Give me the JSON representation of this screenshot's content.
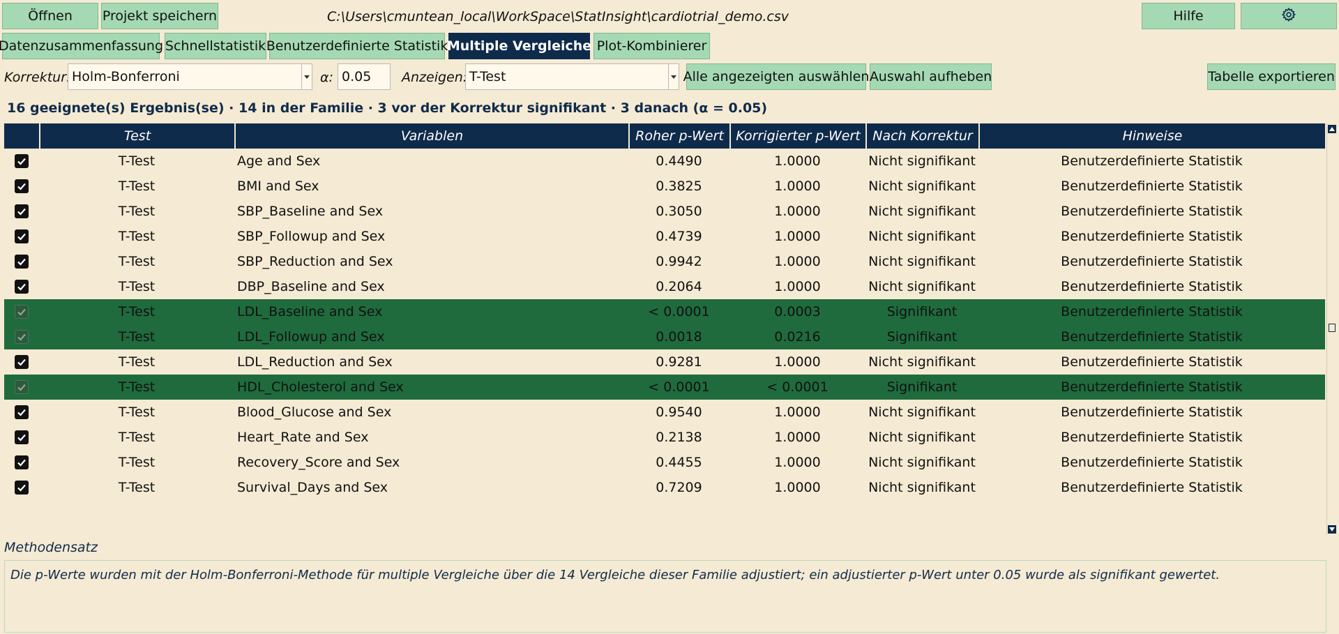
{
  "toolbar": {
    "open_label": "Öffnen",
    "save_label": "Projekt speichern",
    "file_path": "C:\\Users\\cmuntean_local\\WorkSpace\\StatInsight\\cardiotrial_demo.csv",
    "help_label": "Hilfe",
    "settings_icon": "gear-icon"
  },
  "tabs": [
    {
      "label": "Datenzusammenfassung",
      "active": false
    },
    {
      "label": "Schnellstatistik",
      "active": false
    },
    {
      "label": "Benutzerdefinierte Statistik",
      "active": false
    },
    {
      "label": "Multiple Vergleiche",
      "active": true
    },
    {
      "label": "Plot-Kombinierer",
      "active": false
    }
  ],
  "controls": {
    "correction_label": "Korrektur:",
    "correction_value": "Holm-Bonferroni",
    "alpha_label": "α:",
    "alpha_value": "0.05",
    "show_label": "Anzeigen:",
    "show_value": "T-Test",
    "select_all_label": "Alle angezeigten auswählen",
    "deselect_label": "Auswahl aufheben",
    "export_label": "Tabelle exportieren"
  },
  "summary": "16 geeignete(s) Ergebnis(se) · 14 in der Familie · 3 vor der Korrektur signifikant · 3 danach (α = 0.05)",
  "table": {
    "headers": [
      "Test",
      "Variablen",
      "Roher p-Wert",
      "Korrigierter p-Wert",
      "Nach Korrektur",
      "Hinweise"
    ],
    "rows": [
      {
        "test": "T-Test",
        "vars": "Age and Sex",
        "raw": "0.4490",
        "corr": "1.0000",
        "after": "Nicht signifikant",
        "note": "Benutzerdefinierte Statistik",
        "sig": false
      },
      {
        "test": "T-Test",
        "vars": "BMI and Sex",
        "raw": "0.3825",
        "corr": "1.0000",
        "after": "Nicht signifikant",
        "note": "Benutzerdefinierte Statistik",
        "sig": false
      },
      {
        "test": "T-Test",
        "vars": "SBP_Baseline and Sex",
        "raw": "0.3050",
        "corr": "1.0000",
        "after": "Nicht signifikant",
        "note": "Benutzerdefinierte Statistik",
        "sig": false
      },
      {
        "test": "T-Test",
        "vars": "SBP_Followup and Sex",
        "raw": "0.4739",
        "corr": "1.0000",
        "after": "Nicht signifikant",
        "note": "Benutzerdefinierte Statistik",
        "sig": false
      },
      {
        "test": "T-Test",
        "vars": "SBP_Reduction and Sex",
        "raw": "0.9942",
        "corr": "1.0000",
        "after": "Nicht signifikant",
        "note": "Benutzerdefinierte Statistik",
        "sig": false
      },
      {
        "test": "T-Test",
        "vars": "DBP_Baseline and Sex",
        "raw": "0.2064",
        "corr": "1.0000",
        "after": "Nicht signifikant",
        "note": "Benutzerdefinierte Statistik",
        "sig": false
      },
      {
        "test": "T-Test",
        "vars": "LDL_Baseline and Sex",
        "raw": "< 0.0001",
        "corr": "0.0003",
        "after": "Signifikant",
        "note": "Benutzerdefinierte Statistik",
        "sig": true
      },
      {
        "test": "T-Test",
        "vars": "LDL_Followup and Sex",
        "raw": "0.0018",
        "corr": "0.0216",
        "after": "Signifikant",
        "note": "Benutzerdefinierte Statistik",
        "sig": true
      },
      {
        "test": "T-Test",
        "vars": "LDL_Reduction and Sex",
        "raw": "0.9281",
        "corr": "1.0000",
        "after": "Nicht signifikant",
        "note": "Benutzerdefinierte Statistik",
        "sig": false
      },
      {
        "test": "T-Test",
        "vars": "HDL_Cholesterol and Sex",
        "raw": "< 0.0001",
        "corr": "< 0.0001",
        "after": "Signifikant",
        "note": "Benutzerdefinierte Statistik",
        "sig": true
      },
      {
        "test": "T-Test",
        "vars": "Blood_Glucose and Sex",
        "raw": "0.9540",
        "corr": "1.0000",
        "after": "Nicht signifikant",
        "note": "Benutzerdefinierte Statistik",
        "sig": false
      },
      {
        "test": "T-Test",
        "vars": "Heart_Rate and Sex",
        "raw": "0.2138",
        "corr": "1.0000",
        "after": "Nicht signifikant",
        "note": "Benutzerdefinierte Statistik",
        "sig": false
      },
      {
        "test": "T-Test",
        "vars": "Recovery_Score and Sex",
        "raw": "0.4455",
        "corr": "1.0000",
        "after": "Nicht signifikant",
        "note": "Benutzerdefinierte Statistik",
        "sig": false
      },
      {
        "test": "T-Test",
        "vars": "Survival_Days and Sex",
        "raw": "0.7209",
        "corr": "1.0000",
        "after": "Nicht signifikant",
        "note": "Benutzerdefinierte Statistik",
        "sig": false
      }
    ]
  },
  "methods": {
    "label": "Methodensatz",
    "text": "Die p-Werte wurden mit der Holm-Bonferroni-Methode für multiple Vergleiche über die 14 Vergleiche dieser Familie adjustiert; ein adjustierter p-Wert unter 0.05 wurde als signifikant gewertet."
  },
  "colors": {
    "background": "#f5ead3",
    "button": "#a5d9b4",
    "header": "#0f2b4b",
    "significant_row": "#1f6b3d"
  }
}
